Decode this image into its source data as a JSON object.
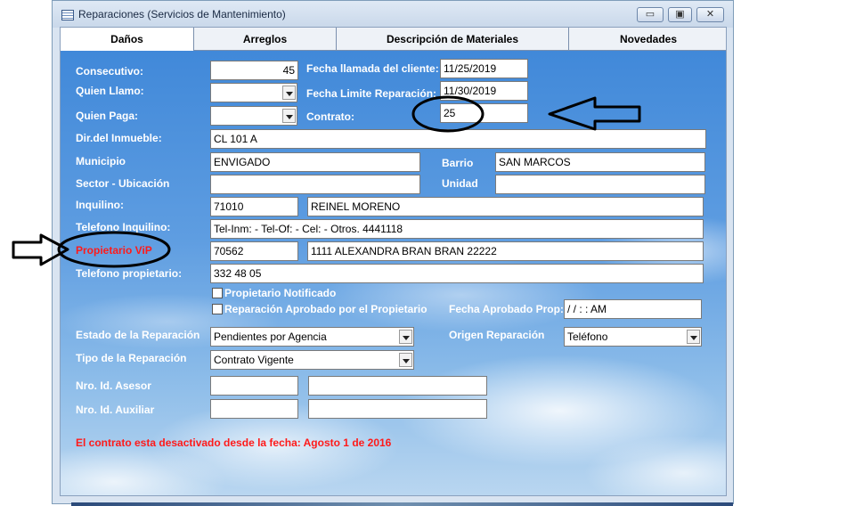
{
  "window": {
    "title": "Reparaciones (Servicios de Mantenimiento)",
    "minimize_icon": "minimize-icon",
    "maximize_icon": "maximize-icon",
    "close_icon": "close-icon",
    "min_glyph": "▭",
    "max_glyph": "▣",
    "close_glyph": "✕"
  },
  "tabs": [
    {
      "label": "Daños",
      "active": true
    },
    {
      "label": "Arreglos",
      "active": false
    },
    {
      "label": "Descripción de Materiales",
      "active": false
    },
    {
      "label": "Novedades",
      "active": false
    }
  ],
  "form": {
    "consecutivo": {
      "label": "Consecutivo:",
      "value": "45"
    },
    "quien_llamo": {
      "label": "Quien Llamo:",
      "value": ""
    },
    "quien_paga": {
      "label": "Quien Paga:",
      "value": ""
    },
    "fecha_llamada": {
      "label": "Fecha llamada del cliente:",
      "value": "11/25/2019"
    },
    "fecha_limite": {
      "label": "Fecha Limite Reparación:",
      "value": "11/30/2019"
    },
    "contrato": {
      "label": "Contrato:",
      "value": "25"
    },
    "direccion": {
      "label": "Dir.del Inmueble:",
      "value": "CL 101 A"
    },
    "municipio": {
      "label": "Municipio",
      "value": "ENVIGADO"
    },
    "barrio": {
      "label": "Barrio",
      "value": "SAN MARCOS"
    },
    "sector": {
      "label": "Sector - Ubicación",
      "value": ""
    },
    "unidad": {
      "label": "Unidad",
      "value": ""
    },
    "inquilino": {
      "label": "Inquilino:",
      "id": "71010",
      "name": "REINEL MORENO"
    },
    "telefono_inquilino": {
      "label": "Telefono Inquilino:",
      "value": "Tel-Inm:  - Tel-Of:  - Cel:  - Otros. 4441118"
    },
    "propietario": {
      "label": "Propietario ViP",
      "id": "70562",
      "name": "1111 ALEXANDRA BRAN BRAN 22222"
    },
    "telefono_propietario": {
      "label": "Telefono propietario:",
      "value": "332 48 05"
    },
    "propietario_notificado": {
      "label": "Propietario Notificado",
      "checked": false
    },
    "reparacion_aprobada": {
      "label": "Reparación Aprobado por el Propietario",
      "checked": false
    },
    "fecha_aprobado": {
      "label": "Fecha Aprobado Prop:",
      "value": " / /      :  :   AM"
    },
    "estado": {
      "label": "Estado de la Reparación",
      "value": "Pendientes por Agencia"
    },
    "origen": {
      "label": "Origen Reparación",
      "value": "Teléfono"
    },
    "tipo": {
      "label": "Tipo de la Reparación",
      "value": "Contrato Vigente"
    },
    "asesor": {
      "label": "Nro. Id. Asesor",
      "id": "",
      "name": ""
    },
    "auxiliar": {
      "label": "Nro. Id. Auxiliar",
      "id": "",
      "name": ""
    }
  },
  "message": "El contrato esta desactivado desde la fecha: Agosto 1 de 2016",
  "annotations": {
    "right_arrow_icon": "right-arrow-outline-icon",
    "left_arrow_icon": "left-arrow-outline-icon",
    "ellipse_contrato": "circle-annotation-icon",
    "ellipse_propietario": "circle-annotation-icon"
  },
  "colors": {
    "label_text": "#ffffff",
    "alert_text": "#ff1a1a",
    "sky_top": "#3d86d8",
    "sky_bottom": "#b9d6f0"
  }
}
